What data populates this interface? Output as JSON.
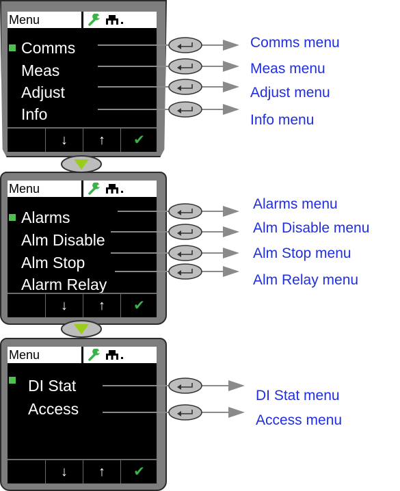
{
  "panels": [
    {
      "header": "Menu",
      "items": [
        {
          "label": "Comms",
          "target": "Comms menu",
          "selected": true
        },
        {
          "label": "Meas",
          "target": "Meas menu",
          "selected": false
        },
        {
          "label": "Adjust",
          "target": "Adjust menu",
          "selected": false
        },
        {
          "label": "Info",
          "target": "Info menu",
          "selected": false
        }
      ]
    },
    {
      "header": "Menu",
      "items": [
        {
          "label": "Alarms",
          "target": "Alarms menu",
          "selected": true
        },
        {
          "label": "Alm Disable",
          "target": "Alm Disable menu",
          "selected": false
        },
        {
          "label": "Alm Stop",
          "target": "Alm Stop menu",
          "selected": false
        },
        {
          "label": "Alarm Relay",
          "target": "Alm Relay menu",
          "selected": false
        }
      ]
    },
    {
      "header": "Menu",
      "items": [
        {
          "label": "DI Stat",
          "target": "DI Stat menu",
          "selected": true
        },
        {
          "label": "Access",
          "target": "Access menu",
          "selected": false
        }
      ]
    }
  ],
  "softkeys": {
    "down": "↓",
    "up": "↑",
    "confirm": "✔"
  },
  "colors": {
    "target_text": "#1f2ee0",
    "selection": "#4fbf4f",
    "confirm": "#3cb24a",
    "connector": "#9acd1a"
  }
}
